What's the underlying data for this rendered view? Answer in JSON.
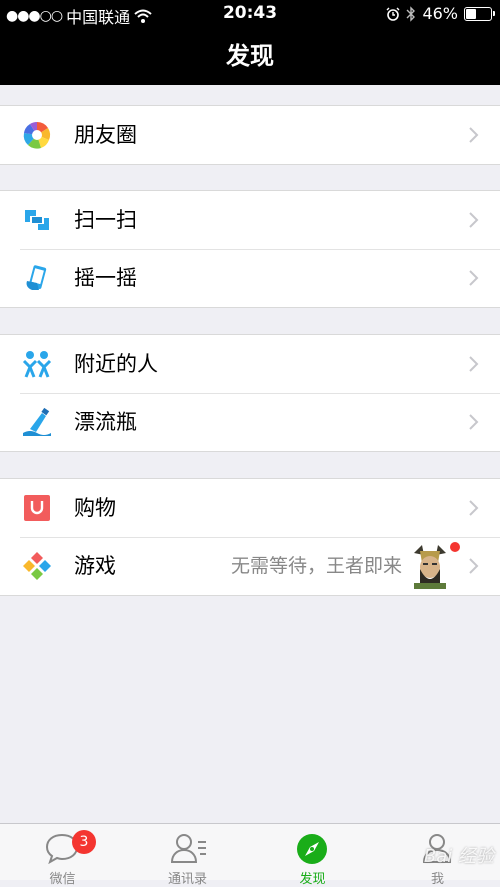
{
  "status": {
    "signal": "●●●○○",
    "carrier": "中国联通",
    "time": "20:43",
    "battery_text": "46%",
    "battery_level": 0.46
  },
  "nav": {
    "title": "发现"
  },
  "groups": [
    [
      {
        "label": "朋友圈",
        "icon": "moments-icon"
      }
    ],
    [
      {
        "label": "扫一扫",
        "icon": "scan-icon"
      },
      {
        "label": "摇一摇",
        "icon": "shake-icon"
      }
    ],
    [
      {
        "label": "附近的人",
        "icon": "people-nearby-icon"
      },
      {
        "label": "漂流瓶",
        "icon": "drift-bottle-icon"
      }
    ],
    [
      {
        "label": "购物",
        "icon": "shopping-icon"
      },
      {
        "label": "游戏",
        "icon": "games-icon",
        "hint": "无需等待，王者即来"
      }
    ]
  ],
  "tabs": [
    {
      "label": "微信",
      "icon": "chat-icon",
      "badge": "3"
    },
    {
      "label": "通讯录",
      "icon": "contacts-icon"
    },
    {
      "label": "发现",
      "icon": "compass-icon",
      "active": true
    },
    {
      "label": "我",
      "icon": "me-icon"
    }
  ],
  "colors": {
    "accent": "#1aad19",
    "badge": "#f43530",
    "background": "#efeff4"
  },
  "watermark": "Bai 经验"
}
